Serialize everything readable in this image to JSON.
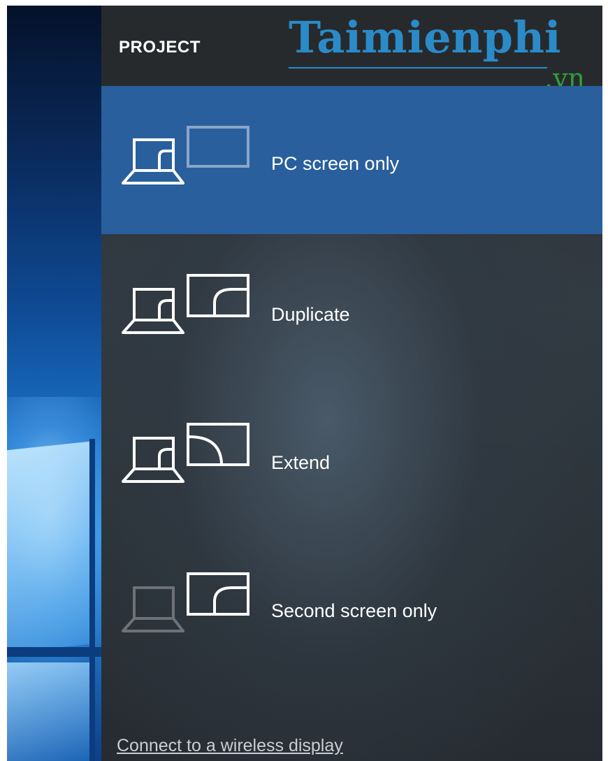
{
  "panel": {
    "title": "PROJECT"
  },
  "watermark": {
    "name": "Taimienphi",
    "tld": ".vn"
  },
  "options": [
    {
      "label": "PC screen only",
      "icon": "pc-screen-only-icon",
      "selected": true
    },
    {
      "label": "Duplicate",
      "icon": "duplicate-icon",
      "selected": false
    },
    {
      "label": "Extend",
      "icon": "extend-icon",
      "selected": false
    },
    {
      "label": "Second screen only",
      "icon": "second-screen-only-icon",
      "selected": false
    }
  ],
  "wireless_link": "Connect to a wireless display",
  "colors": {
    "selected_bg": "#295f9c",
    "header_bg": "#272a2d",
    "panel_bg": "#2e3338",
    "icon_white": "#ffffff",
    "icon_dim": "#6e7278",
    "watermark_blue": "#2a8bc8",
    "watermark_green": "#2f9e3b"
  }
}
